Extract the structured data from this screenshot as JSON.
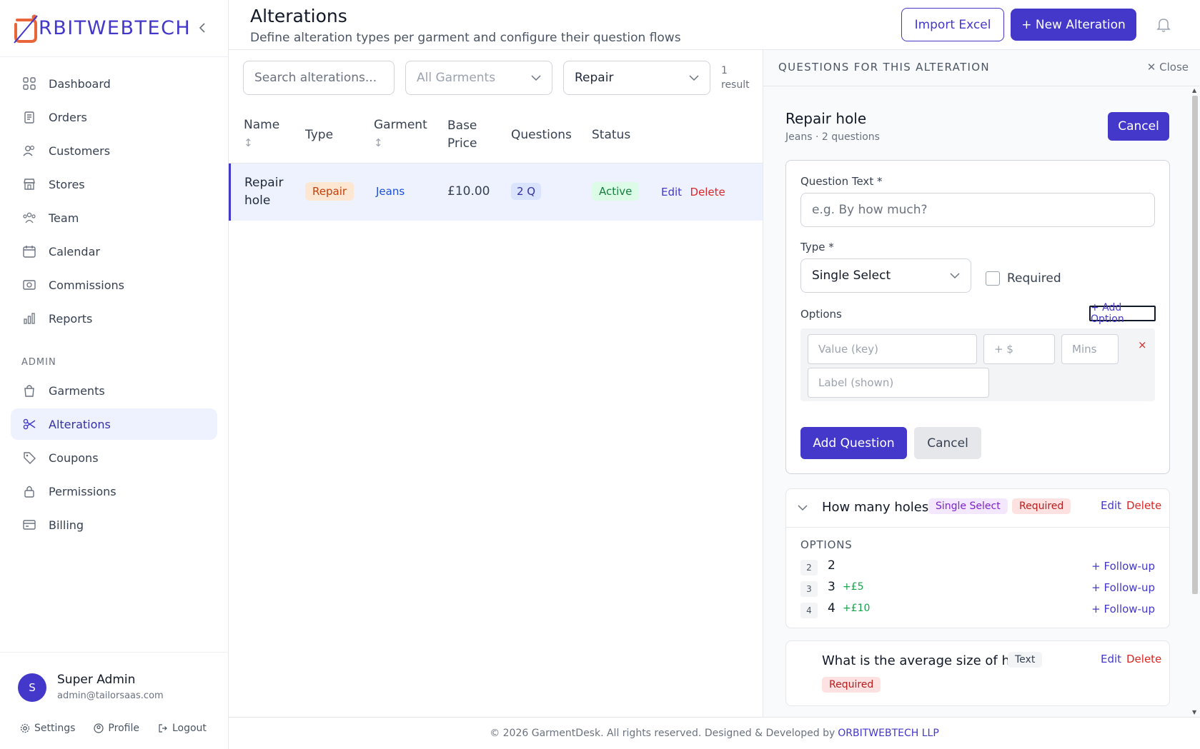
{
  "brand": {
    "name": "RBITWEBTECH",
    "logo_letter": "O"
  },
  "sidebar": {
    "items": [
      {
        "label": "Dashboard",
        "icon": "dashboard-icon"
      },
      {
        "label": "Orders",
        "icon": "orders-icon"
      },
      {
        "label": "Customers",
        "icon": "customers-icon"
      },
      {
        "label": "Stores",
        "icon": "stores-icon"
      },
      {
        "label": "Team",
        "icon": "team-icon"
      },
      {
        "label": "Calendar",
        "icon": "calendar-icon"
      },
      {
        "label": "Commissions",
        "icon": "commissions-icon"
      },
      {
        "label": "Reports",
        "icon": "reports-icon"
      }
    ],
    "admin_section": "ADMIN",
    "admin_items": [
      {
        "label": "Garments",
        "icon": "bag-icon"
      },
      {
        "label": "Alterations",
        "icon": "scissors-icon",
        "active": true
      },
      {
        "label": "Coupons",
        "icon": "tag-icon"
      },
      {
        "label": "Permissions",
        "icon": "lock-icon"
      },
      {
        "label": "Billing",
        "icon": "card-icon"
      }
    ]
  },
  "user": {
    "initial": "S",
    "name": "Super Admin",
    "email": "admin@tailorsaas.com",
    "settings": "Settings",
    "profile": "Profile",
    "logout": "Logout"
  },
  "header": {
    "title": "Alterations",
    "subtitle": "Define alteration types per garment and configure their question flows",
    "import_label": "Import Excel",
    "new_label": "+ New Alteration"
  },
  "filters": {
    "search_placeholder": "Search alterations...",
    "garment_value": "All Garments",
    "type_value": "Repair",
    "result_count": "1",
    "result_word": "result"
  },
  "table": {
    "columns": {
      "name": "Name",
      "type": "Type",
      "garment": "Garment",
      "base_price_1": "Base",
      "base_price_2": "Price",
      "questions": "Questions",
      "status": "Status"
    },
    "rows": [
      {
        "name_1": "Repair",
        "name_2": "hole",
        "type": "Repair",
        "garment": "Jeans",
        "price": "£10.00",
        "questions": "2 Q",
        "status": "Active",
        "edit": "Edit",
        "delete": "Delete"
      }
    ]
  },
  "panel": {
    "title": "QUESTIONS FOR THIS ALTERATION",
    "close": "Close",
    "alteration_name": "Repair hole",
    "alteration_meta": "Jeans · 2 questions",
    "cancel_top": "Cancel",
    "form": {
      "question_label": "Question Text *",
      "question_placeholder": "e.g. By how much?",
      "type_label": "Type *",
      "type_value": "Single Select",
      "required_label": "Required",
      "options_label": "Options",
      "add_option": "+ Add Option",
      "value_placeholder": "Value (key)",
      "price_placeholder": "+ $",
      "mins_placeholder": "Mins",
      "label_placeholder": "Label (shown)",
      "remove": "×",
      "add_question": "Add Question",
      "cancel": "Cancel"
    },
    "questions": [
      {
        "text": "How many holes?",
        "type": "Single Select",
        "required": "Required",
        "edit": "Edit",
        "delete": "Delete",
        "options_head": "OPTIONS",
        "options": [
          {
            "num": "2",
            "value": "2",
            "price": "",
            "follow": "+ Follow-up"
          },
          {
            "num": "3",
            "value": "3",
            "price": "+£5",
            "follow": "+ Follow-up"
          },
          {
            "num": "4",
            "value": "4",
            "price": "+£10",
            "follow": "+ Follow-up"
          }
        ]
      },
      {
        "text": "What is the average size of hole?",
        "type": "Text",
        "required": "Required",
        "edit": "Edit",
        "delete": "Delete"
      }
    ]
  },
  "footer": {
    "text": "© 2026 GarmentDesk. All rights reserved. Designed & Developed by",
    "brand": "ORBITWEBTECH LLP"
  },
  "colors": {
    "accent": "#4338ca",
    "danger": "#dc2626",
    "success": "#16a34a"
  }
}
